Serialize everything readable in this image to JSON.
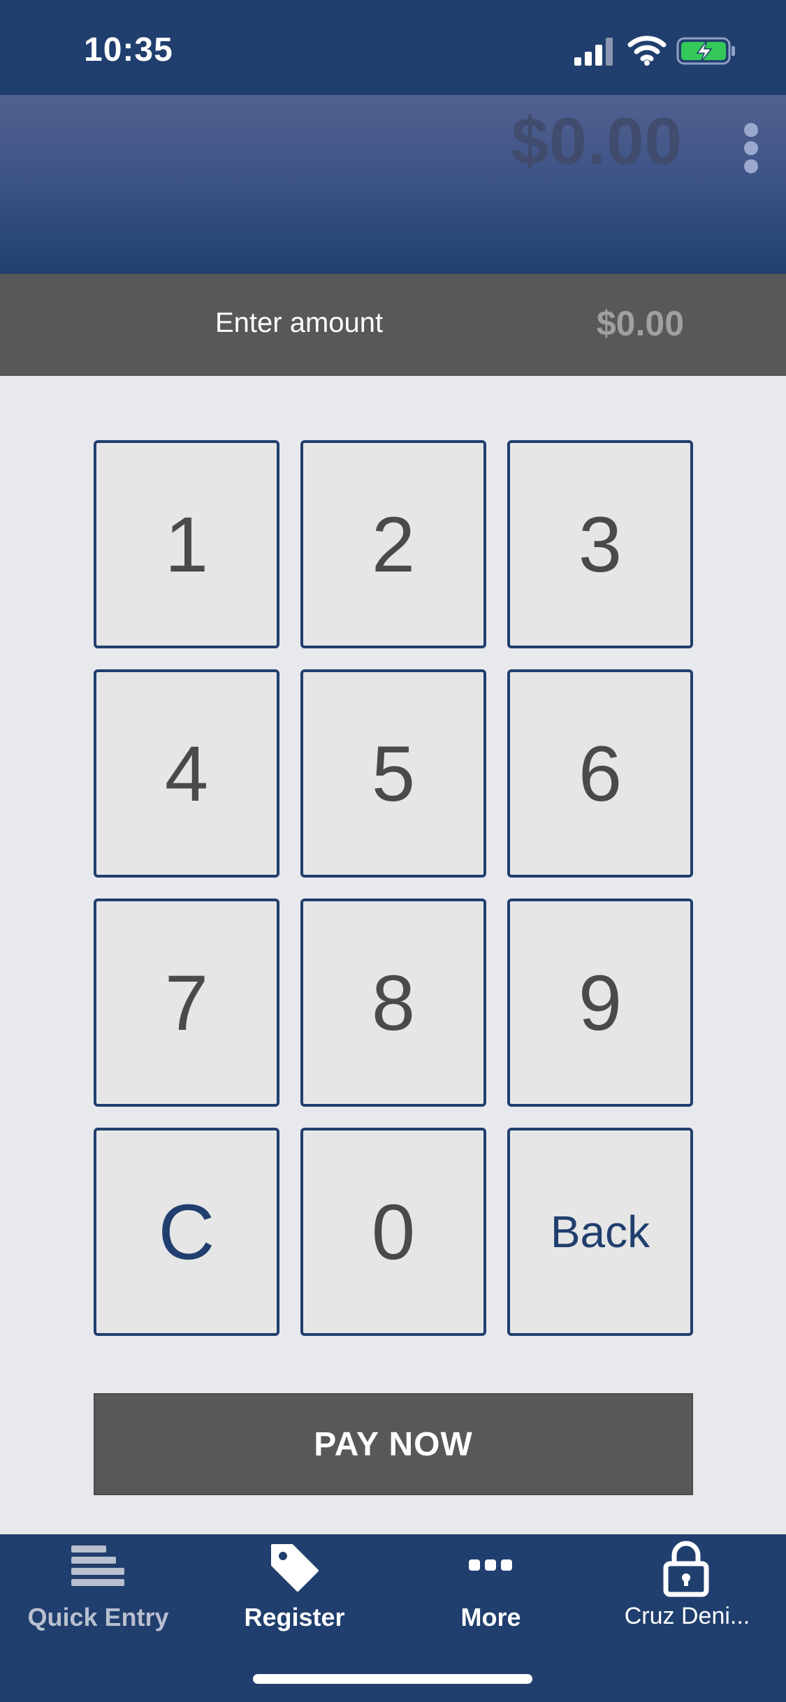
{
  "status_bar": {
    "time": "10:35"
  },
  "header": {
    "total": "$0.00"
  },
  "amount": {
    "label": "Enter amount",
    "value": "$0.00"
  },
  "keypad": {
    "k1": "1",
    "k2": "2",
    "k3": "3",
    "k4": "4",
    "k5": "5",
    "k6": "6",
    "k7": "7",
    "k8": "8",
    "k9": "9",
    "clear": "C",
    "k0": "0",
    "back": "Back"
  },
  "pay_button": {
    "label": "PAY NOW"
  },
  "tabs": [
    {
      "label": "Quick Entry",
      "icon": "lines-icon"
    },
    {
      "label": "Register",
      "icon": "tag-icon"
    },
    {
      "label": "More",
      "icon": "more-dots-icon"
    },
    {
      "label": "Cruz Deni...",
      "icon": "lock-icon"
    }
  ],
  "colors": {
    "primary": "#203f6e",
    "strip": "#585858",
    "key_bg": "#e6e6e6",
    "battery": "#34c759"
  }
}
